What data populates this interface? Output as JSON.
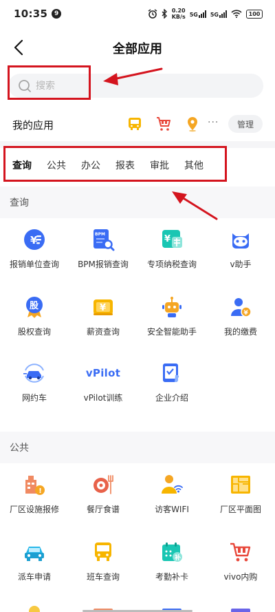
{
  "status": {
    "time": "10:35",
    "notification_count": "9",
    "speed_value": "0.20",
    "speed_unit": "KB/s",
    "sig1": "5G",
    "sig2": "5G",
    "battery": "100"
  },
  "nav": {
    "title": "全部应用"
  },
  "search": {
    "placeholder": "搜索"
  },
  "my_apps": {
    "title": "我的应用",
    "icons": [
      "bus-icon",
      "cart-icon",
      "location-pin-icon"
    ],
    "more": "···",
    "manage_label": "管理"
  },
  "tabs": [
    {
      "label": "查询",
      "active": true
    },
    {
      "label": "公共",
      "active": false
    },
    {
      "label": "办公",
      "active": false
    },
    {
      "label": "报表",
      "active": false
    },
    {
      "label": "审批",
      "active": false
    },
    {
      "label": "其他",
      "active": false
    }
  ],
  "sections": [
    {
      "title": "查询",
      "apps": [
        {
          "label": "报销单位查询",
          "icon": "reimburse-icon"
        },
        {
          "label": "BPM报销查询",
          "icon": "bpm-search-icon"
        },
        {
          "label": "专项纳税查询",
          "icon": "tax-icon"
        },
        {
          "label": "v助手",
          "icon": "assistant-icon"
        },
        {
          "label": "股权查询",
          "icon": "equity-icon"
        },
        {
          "label": "薪资查询",
          "icon": "salary-icon"
        },
        {
          "label": "安全智能助手",
          "icon": "robot-icon"
        },
        {
          "label": "我的缴费",
          "icon": "payment-icon"
        },
        {
          "label": "网约车",
          "icon": "car-icon"
        },
        {
          "label": "vPilot训练",
          "icon": "vpilot-icon"
        },
        {
          "label": "企业介绍",
          "icon": "company-intro-icon"
        }
      ]
    },
    {
      "title": "公共",
      "apps": [
        {
          "label": "厂区设施报修",
          "icon": "facility-repair-icon"
        },
        {
          "label": "餐厅食谱",
          "icon": "restaurant-icon"
        },
        {
          "label": "访客WIFI",
          "icon": "visitor-wifi-icon"
        },
        {
          "label": "厂区平面图",
          "icon": "floor-plan-icon"
        },
        {
          "label": "派车申请",
          "icon": "car-request-icon"
        },
        {
          "label": "班车查询",
          "icon": "shuttle-bus-icon"
        },
        {
          "label": "考勤补卡",
          "icon": "attendance-icon"
        },
        {
          "label": "vivo内购",
          "icon": "shopping-cart-icon"
        }
      ]
    }
  ],
  "vpilot_text": "vPilot",
  "colors": {
    "accent_red": "#d4141e",
    "icon_blue": "#3a6cf4",
    "icon_orange": "#f5a623"
  }
}
